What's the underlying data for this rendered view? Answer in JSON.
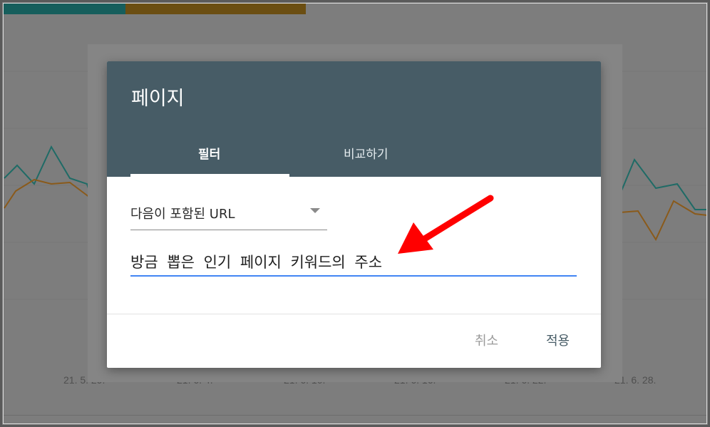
{
  "background": {
    "x_dates": [
      "21. 5. 29.",
      "21. 6. 4.",
      "21. 6. 10.",
      "21. 6. 16.",
      "21. 6. 22.",
      "21. 6. 28."
    ],
    "series_colors": {
      "teal": "#1f6b66",
      "orange": "#8a5a1a"
    }
  },
  "dialog": {
    "title": "페이지",
    "tabs": [
      {
        "label": "필터",
        "active": true
      },
      {
        "label": "비교하기",
        "active": false
      }
    ],
    "match_select": {
      "value": "다음이 포함된 URL"
    },
    "url_input": {
      "value": "방금 뽑은 인기 페이지 키워드의 주소"
    },
    "cancel_label": "취소",
    "apply_label": "적용"
  },
  "annotation": {
    "type": "arrow",
    "color": "#ff0000",
    "icon": "red-pointer-arrow-icon"
  },
  "colors": {
    "header": "#475c66",
    "input_focus": "#4285f4",
    "overlay": "#7d7d7d"
  }
}
